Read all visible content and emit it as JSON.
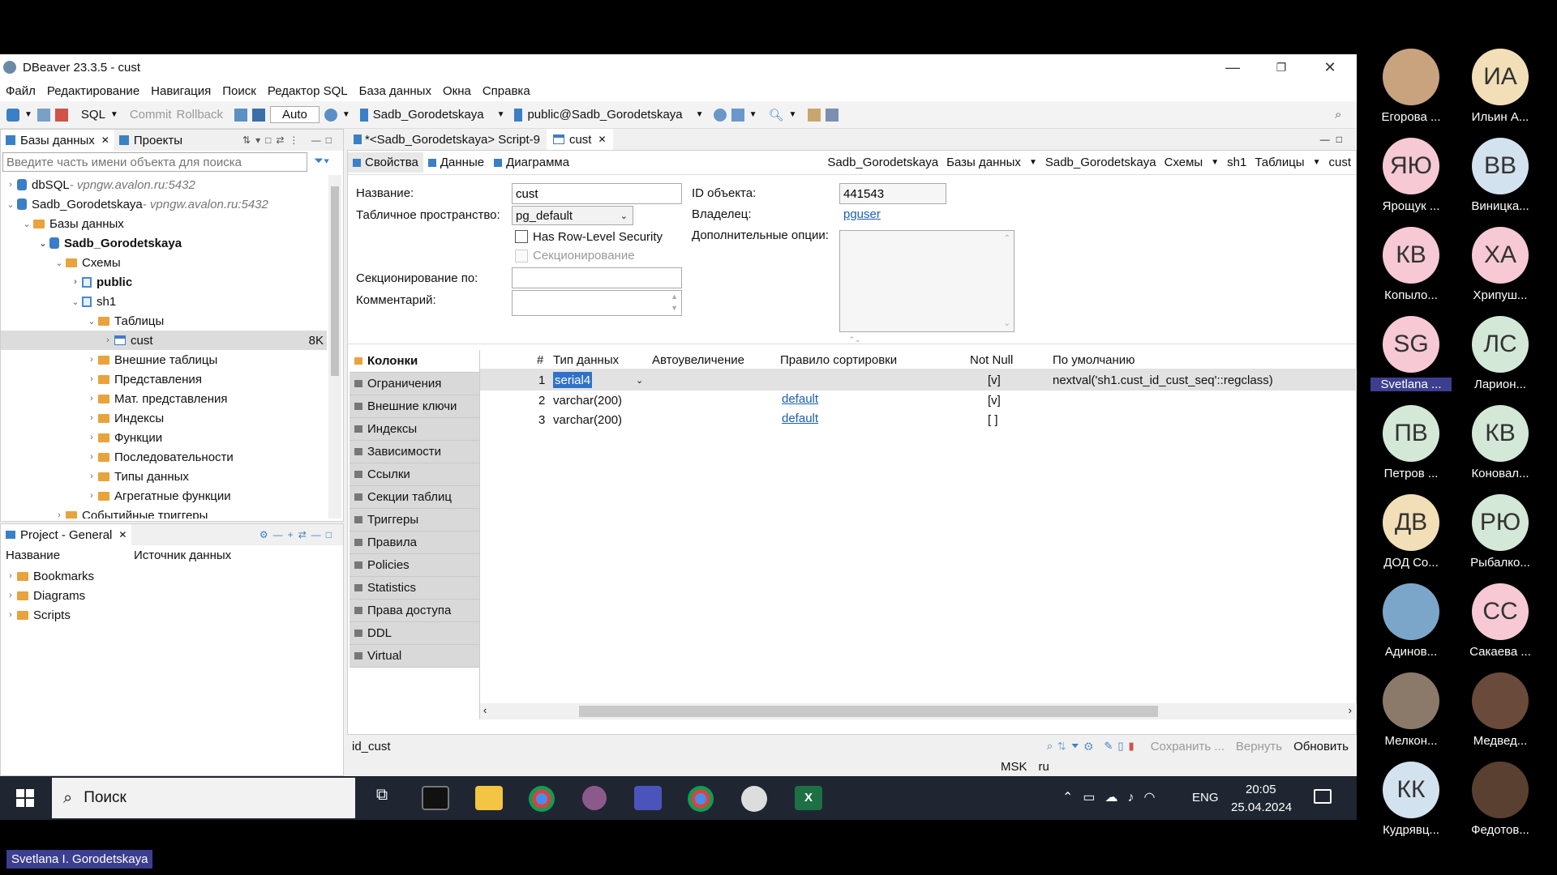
{
  "window": {
    "title": "DBeaver 23.3.5 - cust"
  },
  "menu": [
    "Файл",
    "Редактирование",
    "Навигация",
    "Поиск",
    "Редактор SQL",
    "База данных",
    "Окна",
    "Справка"
  ],
  "toolbar": {
    "sql": "SQL",
    "commit": "Commit",
    "rollback": "Rollback",
    "auto": "Auto",
    "datasource": "Sadb_Gorodetskaya",
    "schema": "public@Sadb_Gorodetskaya"
  },
  "navigator": {
    "tab_db": "Базы данных",
    "tab_projects": "Проекты",
    "search_placeholder": "Введите часть имени объекта для поиска",
    "conn1": "dbSQL",
    "conn1_host": " - vpngw.avalon.ru:5432",
    "conn2": "Sadb_Gorodetskaya",
    "conn2_host": " - vpngw.avalon.ru:5432",
    "databases": "Базы данных",
    "db": "Sadb_Gorodetskaya",
    "schemas": "Схемы",
    "public": "public",
    "sh1": "sh1",
    "tables": "Таблицы",
    "cust": "cust",
    "cust_size": "8K",
    "items": [
      "Внешние таблицы",
      "Представления",
      "Мат. представления",
      "Индексы",
      "Функции",
      "Последовательности",
      "Типы данных",
      "Агрегатные функции"
    ],
    "triggers": "Событийные триггеры"
  },
  "project": {
    "tab": "Project - General",
    "col_name": "Название",
    "col_source": "Источник данных",
    "items": [
      "Bookmarks",
      "Diagrams",
      "Scripts"
    ]
  },
  "editor": {
    "tab1": "*<Sadb_Gorodetskaya> Script-9",
    "tab2": "cust",
    "sub_props": "Свойства",
    "sub_data": "Данные",
    "sub_diagram": "Диаграмма",
    "crumbs": [
      "Sadb_Gorodetskaya",
      "Базы данных",
      "Sadb_Gorodetskaya",
      "Схемы",
      "sh1",
      "Таблицы",
      "cust"
    ],
    "name_label": "Название:",
    "name_value": "cust",
    "tablespace_label": "Табличное пространство:",
    "tablespace_value": "pg_default",
    "rls": "Has Row-Level Security",
    "partitioning": "Секционирование",
    "partby_label": "Секционирование по:",
    "comment_label": "Комментарий:",
    "objid_label": "ID объекта:",
    "objid_value": "441543",
    "owner_label": "Владелец:",
    "owner_value": "pguser",
    "extra_label": "Дополнительные опции:"
  },
  "sections": [
    "Колонки",
    "Ограничения",
    "Внешние ключи",
    "Индексы",
    "Зависимости",
    "Ссылки",
    "Секции таблиц",
    "Триггеры",
    "Правила",
    "Policies",
    "Statistics",
    "Права доступа",
    "DDL",
    "Virtual"
  ],
  "grid": {
    "headers": [
      "#",
      "Тип данных",
      "Автоувеличение",
      "Правило сортировки",
      "Not Null",
      "По умолчанию"
    ],
    "rows": [
      {
        "n": "1",
        "type": "serial4",
        "auto": "",
        "coll": "",
        "nn": "[v]",
        "def": "nextval('sh1.cust_id_cust_seq'::regclass)"
      },
      {
        "n": "2",
        "type": "varchar(200)",
        "auto": "",
        "coll": "default",
        "nn": "[v]",
        "def": ""
      },
      {
        "n": "3",
        "type": "varchar(200)",
        "auto": "",
        "coll": "default",
        "nn": "[ ]",
        "def": ""
      }
    ]
  },
  "statusline": {
    "left": "id_cust",
    "save": "Сохранить ...",
    "revert": "Вернуть",
    "refresh": "Обновить",
    "tz": "MSK",
    "locale": "ru"
  },
  "taskbar": {
    "search": "Поиск",
    "lang": "ENG",
    "time": "20:05",
    "date": "25.04.2024"
  },
  "participants": [
    {
      "initials": "",
      "name": "Егорова ...",
      "color": "#c9a27e"
    },
    {
      "initials": "ИА",
      "name": "Ильин А...",
      "color": "#f2dfb8"
    },
    {
      "initials": "ЯЮ",
      "name": "Ярощук ...",
      "color": "#f6c9d4"
    },
    {
      "initials": "ВВ",
      "name": "Виницка...",
      "color": "#d3e2ef"
    },
    {
      "initials": "КВ",
      "name": "Копыло...",
      "color": "#f6c9d4"
    },
    {
      "initials": "ХА",
      "name": "Хрипуш...",
      "color": "#f6c9d4"
    },
    {
      "initials": "SG",
      "name": "Svetlana ...",
      "color": "#f6c9d4"
    },
    {
      "initials": "ЛС",
      "name": "Ларион...",
      "color": "#d4e8d7"
    },
    {
      "initials": "ПВ",
      "name": "Петров ...",
      "color": "#d4e8d7"
    },
    {
      "initials": "КВ",
      "name": "Коновал...",
      "color": "#d4e8d7"
    },
    {
      "initials": "ДВ",
      "name": "ДОД Co...",
      "color": "#f2dfb8"
    },
    {
      "initials": "РЮ",
      "name": "Рыбалко...",
      "color": "#d4e8d7"
    },
    {
      "initials": "",
      "name": "Адинов...",
      "color": "#7ca6c9"
    },
    {
      "initials": "СС",
      "name": "Сакаева ...",
      "color": "#f6c9d4"
    },
    {
      "initials": "",
      "name": "Мелкон...",
      "color": "#8b7a6a"
    },
    {
      "initials": "",
      "name": "Медвед...",
      "color": "#6a4a3a"
    },
    {
      "initials": "КК",
      "name": "Кудрявц...",
      "color": "#d3e2ef"
    },
    {
      "initials": "",
      "name": "Федотов...",
      "color": "#5a4030"
    }
  ],
  "speaker": "Svetlana I. Gorodetskaya"
}
